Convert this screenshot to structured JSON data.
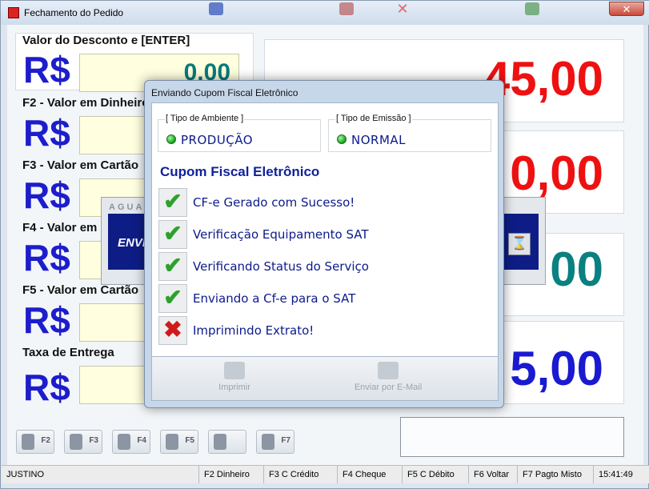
{
  "window": {
    "title": "Fechamento do Pedido",
    "close_glyph": "✕"
  },
  "fields": [
    {
      "label": "Valor do Desconto e [ENTER]",
      "currency": "R$",
      "value": "0,00"
    },
    {
      "label": "F2 - Valor em Dinheiro",
      "currency": "R$",
      "value": ""
    },
    {
      "label": "F3 - Valor em Cartão",
      "currency": "R$",
      "value": ""
    },
    {
      "label": "F4 - Valor em C",
      "currency": "R$",
      "value": ""
    },
    {
      "label": "F5 - Valor em Cartão",
      "currency": "R$",
      "value": ""
    },
    {
      "label": "Taxa de Entrega",
      "currency": "R$",
      "value": ""
    }
  ],
  "totals": [
    {
      "value": "45,00",
      "color": "#ee1111"
    },
    {
      "value": "0,00",
      "color": "#ee1111"
    },
    {
      "value": "00",
      "color": "#0a8080"
    },
    {
      "value": "5,00",
      "color": "#1a1ad0"
    }
  ],
  "fkeys": [
    "F2",
    "F3",
    "F4",
    "F5",
    "",
    "F7"
  ],
  "status_bar": {
    "user": "JUSTINO",
    "items": [
      "F2 Dinheiro",
      "F3 C Crédito",
      "F4 Cheque",
      "F5 C Débito",
      "F6 Voltar",
      "F7 Pagto Misto"
    ],
    "time": "15:41:49"
  },
  "wait_dialog": {
    "title": "AGUA",
    "text": "ENVI",
    "icon": "hourglass-icon"
  },
  "cfe_dialog": {
    "title": "Enviando Cupom Fiscal Eletrônico",
    "ambiente": {
      "label": "[ Tipo de Ambiente ]",
      "value": "PRODUÇÃO"
    },
    "emissao": {
      "label": "[ Tipo de Emissão ]",
      "value": "NORMAL"
    },
    "heading": "Cupom Fiscal Eletrônico",
    "steps": [
      {
        "text": "CF-e Gerado com Sucesso!",
        "status": "ok"
      },
      {
        "text": "Verificação Equipamento SAT",
        "status": "ok"
      },
      {
        "text": "Verificando Status do Serviço",
        "status": "ok"
      },
      {
        "text": "Enviando a Cf-e para o SAT",
        "status": "ok"
      },
      {
        "text": "Imprimindo Extrato!",
        "status": "error"
      }
    ],
    "buttons": {
      "print": "Imprimir",
      "email": "Enviar por E-Mail"
    }
  }
}
